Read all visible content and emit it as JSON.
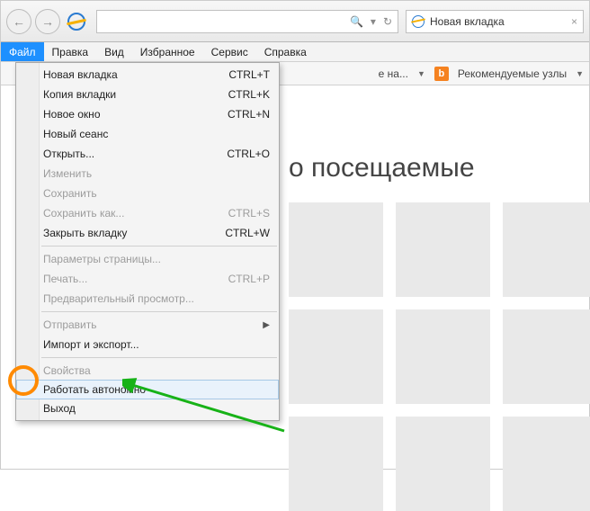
{
  "titlebar": {
    "tab_title": "Новая вкладка"
  },
  "menubar": {
    "items": [
      "Файл",
      "Правка",
      "Вид",
      "Избранное",
      "Сервис",
      "Справка"
    ],
    "active_index": 0
  },
  "toolbar": {
    "suggested_label_fragment": "е на...",
    "bing_label": "b",
    "recommended_label": "Рекомендуемые узлы"
  },
  "page": {
    "heading_fragment": "о посещаемые"
  },
  "dropdown": {
    "items": [
      {
        "label": "Новая вкладка",
        "shortcut": "CTRL+T"
      },
      {
        "label": "Копия вкладки",
        "shortcut": "CTRL+K"
      },
      {
        "label": "Новое окно",
        "shortcut": "CTRL+N"
      },
      {
        "label": "Новый сеанс",
        "shortcut": ""
      },
      {
        "label": "Открыть...",
        "shortcut": "CTRL+O"
      },
      {
        "label": "Изменить",
        "shortcut": "",
        "disabled": true
      },
      {
        "label": "Сохранить",
        "shortcut": "",
        "disabled": true
      },
      {
        "label": "Сохранить как...",
        "shortcut": "CTRL+S",
        "disabled": true
      },
      {
        "label": "Закрыть вкладку",
        "shortcut": "CTRL+W"
      },
      {
        "sep": true
      },
      {
        "label": "Параметры страницы...",
        "shortcut": "",
        "disabled": true
      },
      {
        "label": "Печать...",
        "shortcut": "CTRL+P",
        "disabled": true
      },
      {
        "label": "Предварительный просмотр...",
        "shortcut": "",
        "disabled": true
      },
      {
        "sep": true
      },
      {
        "label": "Отправить",
        "submenu": true,
        "disabled": true
      },
      {
        "label": "Импорт и экспорт...",
        "shortcut": ""
      },
      {
        "sep": true
      },
      {
        "label": "Свойства",
        "shortcut": "",
        "disabled": true
      },
      {
        "label": "Работать автономно",
        "shortcut": "",
        "hover": true
      },
      {
        "label": "Выход",
        "shortcut": ""
      }
    ]
  }
}
